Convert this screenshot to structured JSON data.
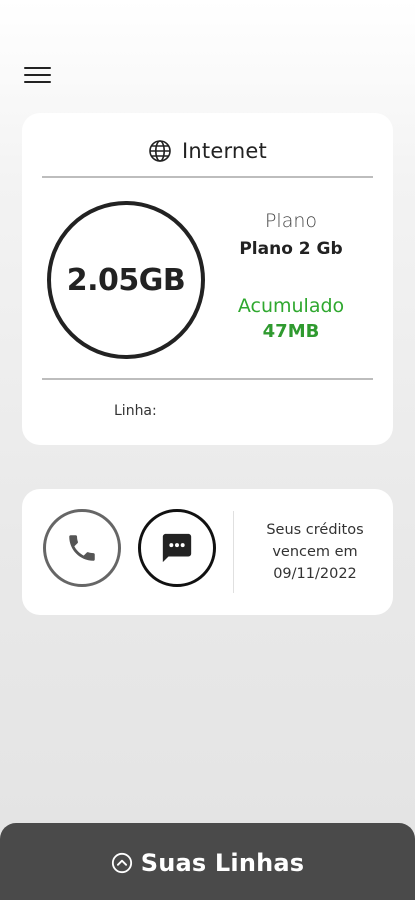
{
  "header": {
    "menu_icon": "hamburger-menu-icon"
  },
  "internet_card": {
    "icon": "globe-icon",
    "title": "Internet",
    "data_amount": "2.05GB",
    "plan_label": "Plano",
    "plan_value": "Plano 2 Gb",
    "accumulated_label": "Acumulado",
    "accumulated_value": "47MB",
    "line_label": "Linha:",
    "accent_color": "#2fa82f"
  },
  "calls_card": {
    "phone_icon": "phone-icon",
    "chat_icon": "chat-icon",
    "credits_line1": "Seus créditos",
    "credits_line2": "vencem em",
    "credits_date": "09/11/2022"
  },
  "bottom_bar": {
    "icon": "chevron-up-circle-icon",
    "label": "Suas Linhas",
    "background_color": "#4a4a4a"
  }
}
